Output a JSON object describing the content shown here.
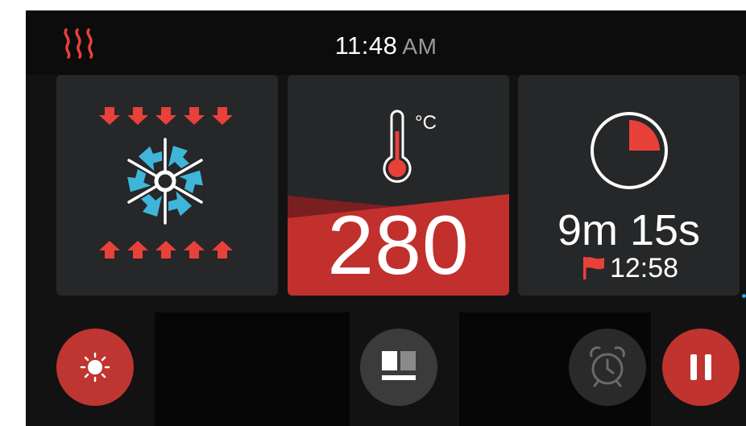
{
  "status_bar": {
    "heat_icon": "heat-waves-icon",
    "time": "11:48",
    "am_pm": "AM"
  },
  "cards": {
    "fan_mode": {
      "icon": "convection-fan-icon"
    },
    "temperature": {
      "icon": "thermometer-icon",
      "unit": "°C",
      "value": "280"
    },
    "timer": {
      "icon": "timer-pie-icon",
      "remaining": "9m 15s",
      "end_icon": "flag-icon",
      "end_time": "12:58",
      "progress_fraction": 0.25
    }
  },
  "controls": {
    "light_icon": "light-sun-icon",
    "view_icon": "layout-view-icon",
    "alarm_icon": "alarm-clock-icon",
    "pause_icon": "pause-icon"
  },
  "colors": {
    "accent_red": "#e8413a",
    "button_red": "#c0332f",
    "fan_blue": "#3fb5d9",
    "card_bg": "#262728"
  }
}
